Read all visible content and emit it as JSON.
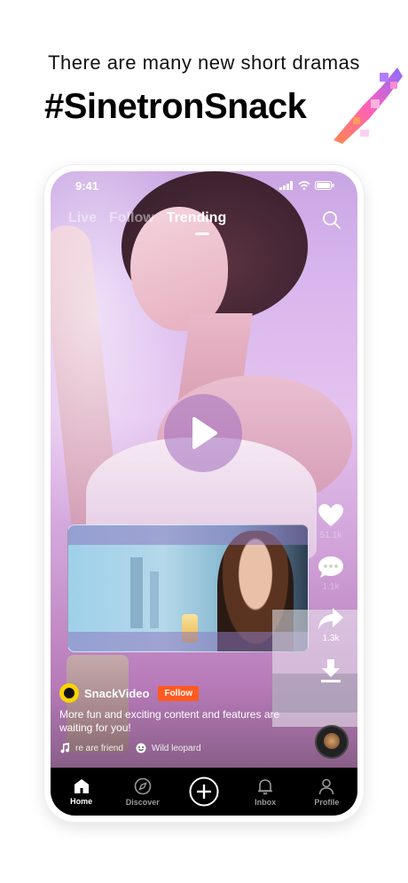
{
  "promo": {
    "tagline": "There are many new short dramas",
    "hashtag": "#SinetronSnack"
  },
  "status_bar": {
    "time": "9:41"
  },
  "top_nav": {
    "tabs": [
      {
        "label": "Live",
        "active": false
      },
      {
        "label": "Follow",
        "active": false
      },
      {
        "label": "Trending",
        "active": true
      }
    ],
    "search_icon": "search-icon"
  },
  "video": {
    "play_icon": "play-icon",
    "creator": {
      "name": "SnackVideo",
      "follow_label": "Follow"
    },
    "description": "More fun and exciting content and features are waiting for you!",
    "music": [
      "re are friend",
      "Wild leopard"
    ]
  },
  "side_actions": [
    {
      "icon": "heart-icon",
      "count": "51.1k",
      "faded": true
    },
    {
      "icon": "comment-icon",
      "count": "1.1k",
      "faded": true
    },
    {
      "icon": "share-icon",
      "count": "1.3k",
      "faded": false
    },
    {
      "icon": "download-icon",
      "count": "",
      "faded": false
    }
  ],
  "bottom_nav": [
    {
      "label": "Home",
      "icon": "home-icon",
      "active": true
    },
    {
      "label": "Discover",
      "icon": "compass-icon",
      "active": false
    },
    {
      "label": "",
      "icon": "plus-icon",
      "active": false
    },
    {
      "label": "Inbox",
      "icon": "bell-icon",
      "active": false
    },
    {
      "label": "Profile",
      "icon": "person-icon",
      "active": false
    }
  ],
  "colors": {
    "accent": "#ff5a1f",
    "logo_yellow": "#f9d400",
    "nav_bg": "#000000"
  }
}
